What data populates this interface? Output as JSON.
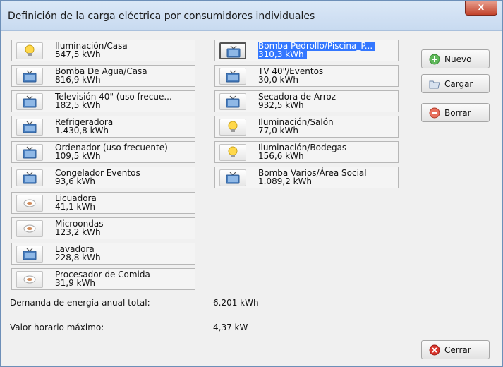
{
  "window": {
    "title": "Definición de la carga eléctrica por consumidores individuales",
    "close_glyph": "x"
  },
  "left_column": [
    {
      "name": "Iluminación/Casa",
      "value": "547,5 kWh",
      "icon": "bulb-icon"
    },
    {
      "name": "Bomba De Agua/Casa",
      "value": "816,9 kWh",
      "icon": "tv-icon"
    },
    {
      "name": "Televisión 40\" (uso frecue...",
      "value": "182,5 kWh",
      "icon": "tv-icon"
    },
    {
      "name": "Refrigeradora",
      "value": "1.430,8 kWh",
      "icon": "tv-icon"
    },
    {
      "name": "Ordenador (uso frecuente)",
      "value": "109,5 kWh",
      "icon": "tv-icon"
    },
    {
      "name": "Congelador Eventos",
      "value": "93,6 kWh",
      "icon": "tv-icon"
    },
    {
      "name": "Licuadora",
      "value": "41,1 kWh",
      "icon": "cup-icon"
    },
    {
      "name": "Microondas",
      "value": "123,2 kWh",
      "icon": "cup-icon"
    },
    {
      "name": "Lavadora",
      "value": "228,8 kWh",
      "icon": "tv-icon"
    },
    {
      "name": "Procesador de Comida",
      "value": "31,9 kWh",
      "icon": "cup-icon"
    }
  ],
  "right_column": [
    {
      "name": "Bomba Pedrollo/Piscina_P...",
      "value": "310,3 kWh",
      "icon": "tv-icon",
      "selected": true
    },
    {
      "name": "TV 40\"/Eventos",
      "value": "30,0 kWh",
      "icon": "tv-icon"
    },
    {
      "name": "Secadora de Arroz",
      "value": "932,5 kWh",
      "icon": "tv-icon"
    },
    {
      "name": "Iluminación/Salón",
      "value": "77,0 kWh",
      "icon": "bulb-icon"
    },
    {
      "name": "Iluminación/Bodegas",
      "value": "156,6 kWh",
      "icon": "bulb-icon"
    },
    {
      "name": "Bomba  Varios/Área Social",
      "value": "1.089,2 kWh",
      "icon": "tv-icon"
    }
  ],
  "stats": {
    "annual_label": "Demanda de energía anual total:",
    "annual_value": "6.201 kWh",
    "peak_label": "Valor horario máximo:",
    "peak_value": "4,37 kW"
  },
  "buttons": {
    "new": "Nuevo",
    "load": "Cargar",
    "delete": "Borrar",
    "close": "Cerrar"
  }
}
